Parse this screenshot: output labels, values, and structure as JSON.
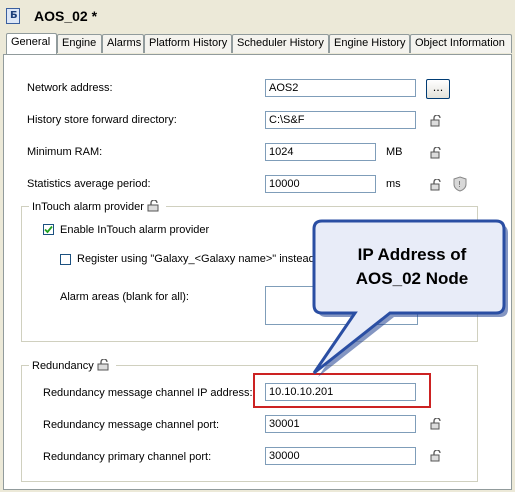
{
  "window": {
    "title": "AOS_02 *",
    "icon": "object-instance-icon"
  },
  "tabs": [
    {
      "label": "General"
    },
    {
      "label": "Engine"
    },
    {
      "label": "Alarms"
    },
    {
      "label": "Platform History"
    },
    {
      "label": "Scheduler History"
    },
    {
      "label": "Engine History"
    },
    {
      "label": "Object Information"
    }
  ],
  "fields": {
    "network_address": {
      "label": "Network address:",
      "value": "AOS2",
      "button": "..."
    },
    "history_dir": {
      "label": "History store forward directory:",
      "value": "C:\\S&F"
    },
    "min_ram": {
      "label": "Minimum RAM:",
      "value": "1024",
      "unit": "MB"
    },
    "stats_period": {
      "label": "Statistics average period:",
      "value": "10000",
      "unit": "ms"
    }
  },
  "intouch_group": {
    "title": "InTouch alarm provider",
    "enable_label": "Enable InTouch alarm provider",
    "enable_checked": true,
    "register_label": "Register using \"Galaxy_<Galaxy name>\" instead of",
    "register_checked": false,
    "areas_label": "Alarm areas (blank for all):"
  },
  "redundancy_group": {
    "title": "Redundancy",
    "ip_label": "Redundancy message channel IP address:",
    "ip_value": "10.10.10.201",
    "port_label": "Redundancy message channel port:",
    "port_value": "30001",
    "primary_label": "Redundancy primary channel port:",
    "primary_value": "30000"
  },
  "callout": {
    "line1": "IP Address of",
    "line2": "AOS_02 Node",
    "color": "#e8ecf8",
    "highlight_color": "#cc2222"
  }
}
